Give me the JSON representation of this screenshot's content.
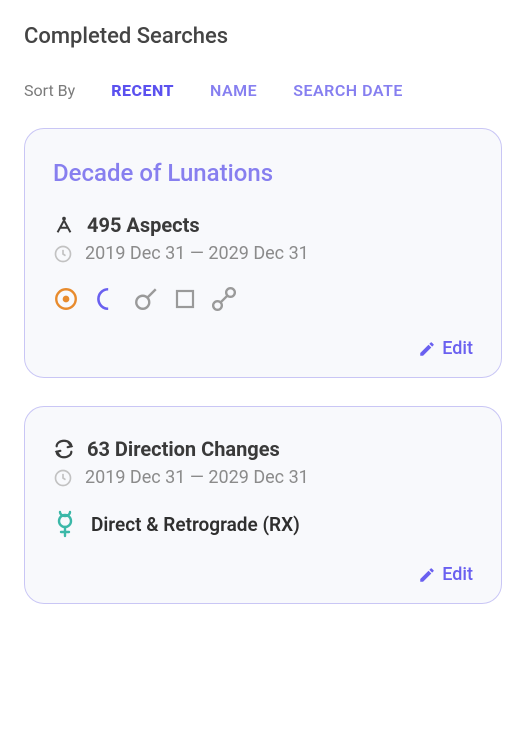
{
  "header": {
    "title": "Completed Searches"
  },
  "sort": {
    "label": "Sort By",
    "options": {
      "recent": "RECENT",
      "name": "NAME",
      "search_date": "SEARCH DATE"
    },
    "active": "recent"
  },
  "cards": [
    {
      "title": "Decade of Lunations",
      "count_text": "495 Aspects",
      "date_range": "2019 Dec 31 — 2029 Dec 31",
      "edit_label": "Edit",
      "glyphs": [
        "sun",
        "moon",
        "conjunction",
        "square",
        "opposition"
      ]
    },
    {
      "title": "",
      "count_text": "63 Direction Changes",
      "date_range": "2019 Dec 31 — 2029 Dec 31",
      "detail_text": "Direct & Retrograde (RX)",
      "edit_label": "Edit"
    }
  ],
  "colors": {
    "accent": "#6a60f0",
    "orange": "#e88b2d",
    "teal": "#3bb8a8",
    "gray": "#9a9a9a",
    "dark": "#3a3a3a"
  }
}
